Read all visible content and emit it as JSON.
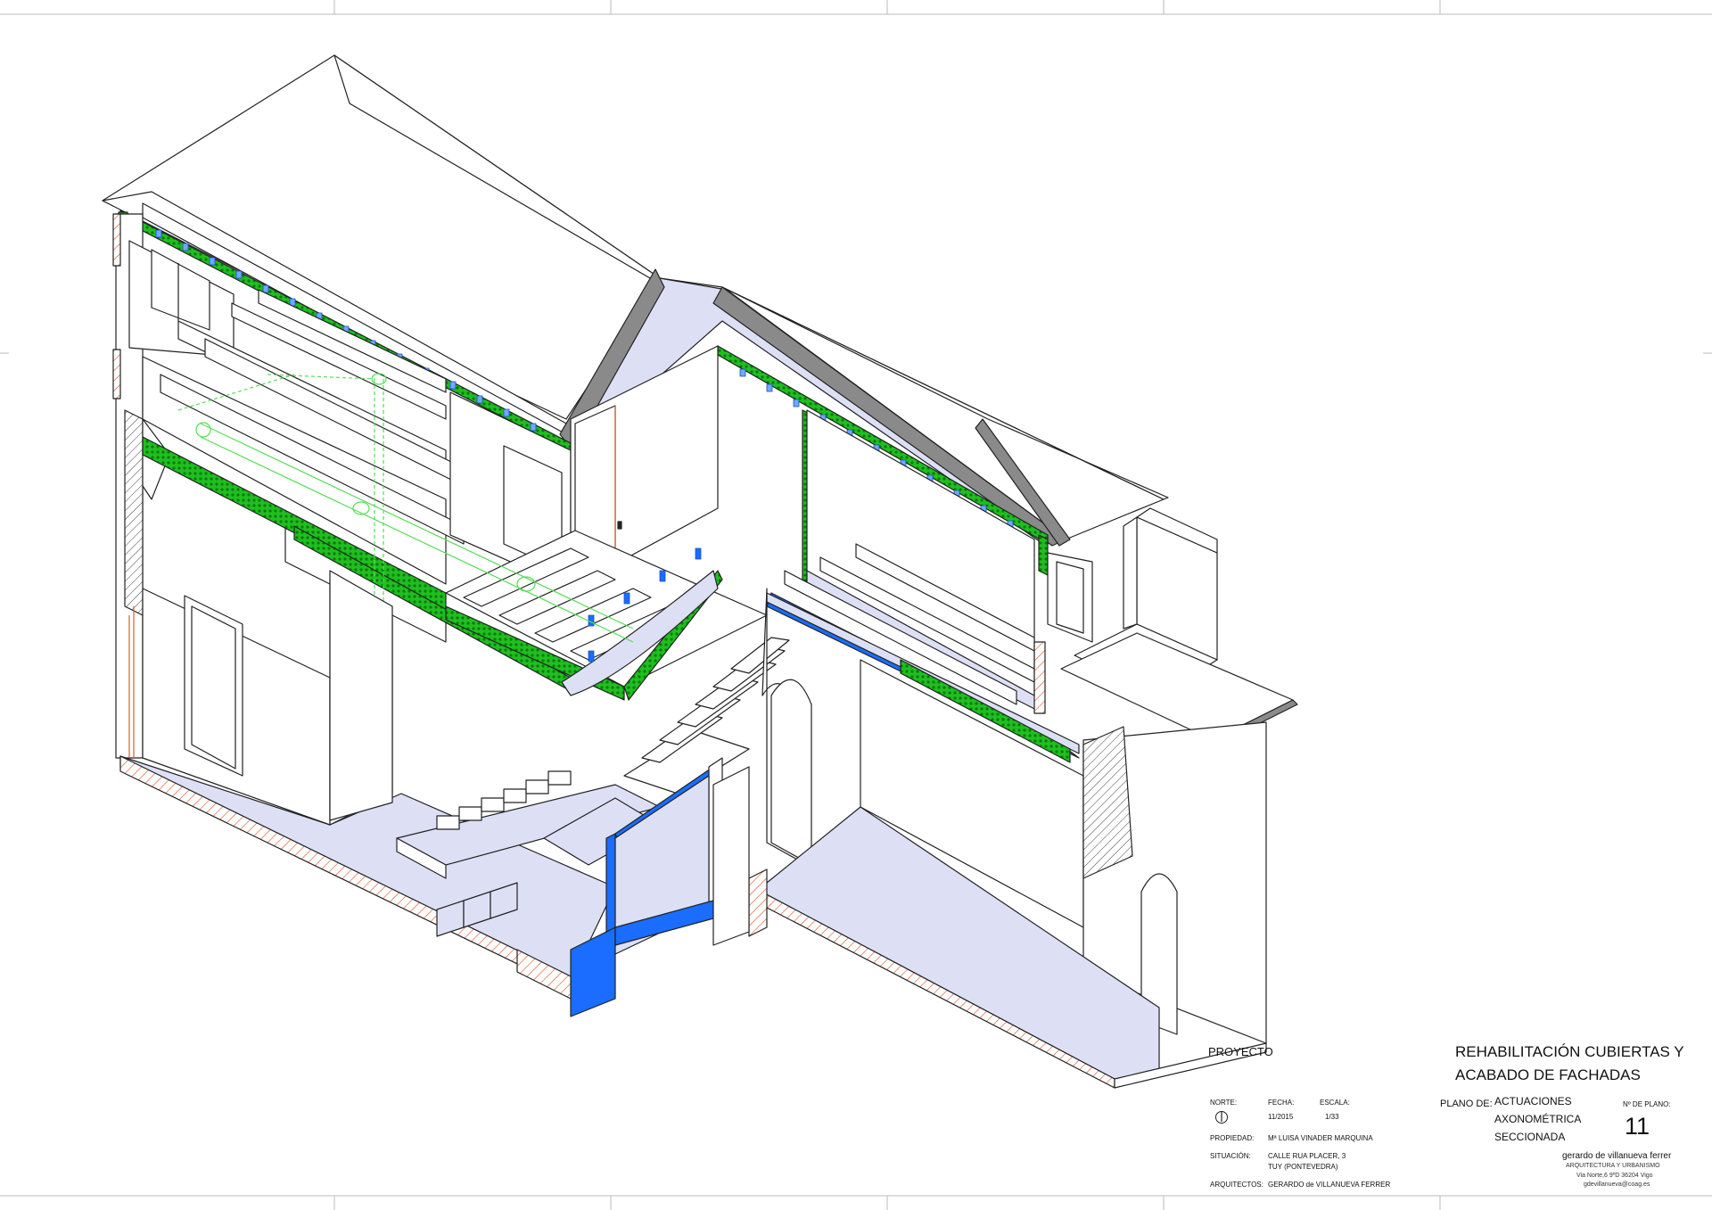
{
  "title_block": {
    "proyecto_label": "PROYECTO",
    "project_title_line1": "REHABILITACIÓN CUBIERTAS Y",
    "project_title_line2": "ACABADO DE FACHADAS",
    "norte_label": "NORTE:",
    "fecha_label": "FECHA:",
    "fecha_value": "11/2015",
    "escala_label": "ESCALA:",
    "escala_value": "1/33",
    "propiedad_label": "PROPIEDAD:",
    "propiedad_value": "Mª LUISA VINADER MARQUINA",
    "situacion_label": "SITUACIÓN:",
    "situacion_line1": "CALLE RUA PLACER, 3",
    "situacion_line2": "TUY (PONTEVEDRA)",
    "arquitectos_label": "ARQUITECTOS:",
    "arquitectos_value": "GERARDO de VILLANUEVA FERRER",
    "plano_de_label": "PLANO DE:",
    "plano_line1": "ACTUACIONES",
    "plano_line2": "AXONOMÉTRICA",
    "plano_line3": "SECCIONADA",
    "num_plano_label": "Nº DE PLANO:",
    "num_plano_value": "11",
    "firm_name": "gerardo de villanueva ferrer",
    "firm_subtitle": "ARQUITECTURA  Y  URBANISMO",
    "firm_address": "Via Norte,6 9ºD  36204 Vigo",
    "firm_email": "gdevillanueva@coag.es"
  },
  "colors": {
    "line": "#222222",
    "interior_fill": "#dde0f5",
    "insulation_green": "#1fbf1f",
    "insulation_dark": "#0a7a0a",
    "waterproof_blue": "#1a6dff",
    "section_hatch": "#e05a2a",
    "installation_green": "#55dd55"
  },
  "icons": [
    "north-arrow-icon"
  ]
}
